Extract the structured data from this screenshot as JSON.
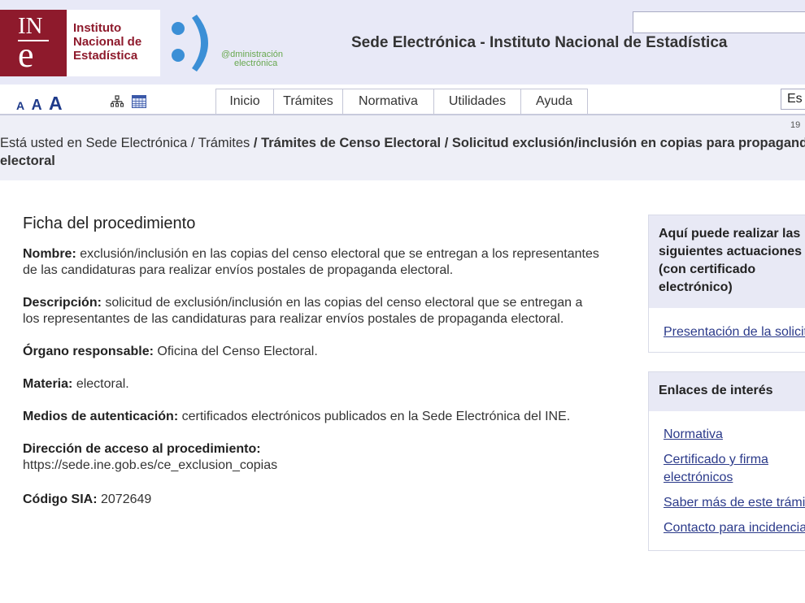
{
  "header": {
    "logo_text": "Instituto Nacional de Estadística",
    "logo_abbr_top": "IN",
    "logo_abbr_bottom": "e",
    "admin_logo_line1": "@dministración",
    "admin_logo_line2": "electrónica",
    "site_title": "Sede Electrónica - Instituto Nacional de Estadística",
    "search_value": "",
    "font_sizes": [
      "A",
      "A",
      "A"
    ],
    "nav_tabs": [
      {
        "label": "Inicio"
      },
      {
        "label": "Trámites"
      },
      {
        "label": "Normativa"
      },
      {
        "label": "Utilidades"
      },
      {
        "label": "Ayuda"
      }
    ],
    "language": "Es",
    "date_fragment": "19"
  },
  "breadcrumb": {
    "prefix": "Está usted en",
    "items": [
      "Sede Electrónica",
      "Trámites",
      "Trámites de Censo Electoral",
      "Solicitud exclusión/inclusión en copias para propaganda electoral"
    ]
  },
  "main": {
    "title": "Ficha del procedimiento",
    "fields": {
      "nombre_label": "Nombre:",
      "nombre_value": "exclusión/inclusión en las copias del censo electoral que se entregan a los representantes de las candidaturas para realizar envíos postales de propaganda electoral.",
      "descripcion_label": "Descripción:",
      "descripcion_value": "solicitud de exclusión/inclusión en las copias del censo electoral que se entregan a los representantes de las candidaturas para realizar envíos postales de propaganda electoral.",
      "organo_label": "Órgano responsable:",
      "organo_value": "Oficina del Censo Electoral.",
      "materia_label": "Materia:",
      "materia_value": "electoral.",
      "medios_label": "Medios de autenticación:",
      "medios_value": "certificados electrónicos publicados en la Sede Electrónica del INE.",
      "direccion_label": "Dirección de acceso al procedimiento:",
      "direccion_value": "https://sede.ine.gob.es/ce_exclusion_copias",
      "sia_label": "Código SIA:",
      "sia_value": "2072649"
    }
  },
  "sidebar": {
    "actions_title": "Aquí puede realizar las siguientes actuaciones (con certificado electrónico)",
    "actions_link": "Presentación de la solicitud",
    "links_title": "Enlaces de interés",
    "links": [
      "Normativa",
      "Certificado y firma electrónicos",
      "Saber más de este trámite",
      "Contacto para incidencias"
    ]
  },
  "colors": {
    "brand": "#8e1a2c",
    "header_bg": "#e8e9f7",
    "link": "#2b3a8a",
    "smiley": "#3b8fd6"
  }
}
